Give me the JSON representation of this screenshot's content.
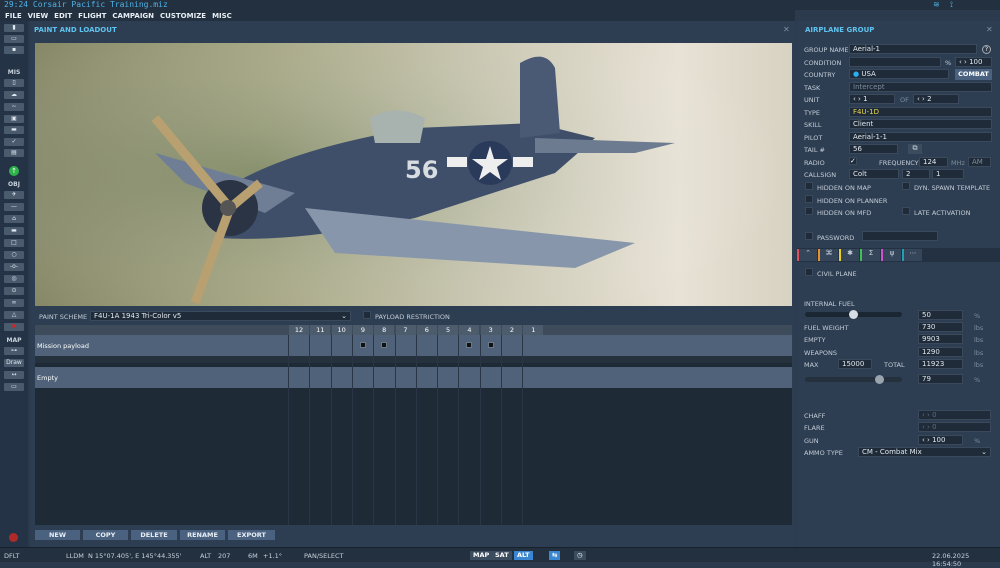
{
  "window": {
    "title": "29:24 Corsair Pacific Training.miz"
  },
  "menu": [
    "FILE",
    "VIEW",
    "EDIT",
    "FLIGHT",
    "CAMPAIGN",
    "CUSTOMIZE",
    "MISC"
  ],
  "toolbar": {
    "sections": [
      "MIS",
      "OBJ",
      "MAP"
    ],
    "map_buttons": [
      "Draw"
    ]
  },
  "loadout": {
    "title": "PAINT AND LOADOUT",
    "paint_scheme_label": "PAINT SCHEME",
    "paint_scheme": "F4U-1A 1943 Tri-Color v5",
    "payload_restriction": "PAYLOAD RESTRICTION",
    "stations": [
      "12",
      "11",
      "10",
      "9",
      "8",
      "7",
      "6",
      "5",
      "4",
      "3",
      "2",
      "1"
    ],
    "rows": [
      {
        "name": "Mission payload",
        "loaded": [
          "9",
          "8",
          "4",
          "3"
        ]
      },
      {
        "name": "Empty",
        "loaded": []
      }
    ],
    "buttons": [
      "NEW",
      "COPY",
      "DELETE",
      "RENAME",
      "EXPORT"
    ],
    "aircraft_marking": "56"
  },
  "group": {
    "title": "AIRPLANE GROUP",
    "group_name_label": "GROUP NAME",
    "group_name": "Aerial-1",
    "help": "?",
    "condition_label": "CONDITION",
    "condition_unit": "%",
    "condition": "100",
    "country_label": "COUNTRY",
    "country": "USA",
    "combat": "COMBAT",
    "task_label": "TASK",
    "task": "Intercept",
    "unit_label": "UNIT",
    "unit": "1",
    "of": "OF",
    "unit_of": "2",
    "type_label": "TYPE",
    "type": "F4U-1D",
    "skill_label": "SKILL",
    "skill": "Client",
    "pilot_label": "PILOT",
    "pilot": "Aerial-1-1",
    "tail_label": "TAIL #",
    "tail": "56",
    "radio_label": "RADIO",
    "frequency_label": "FREQUENCY",
    "frequency": "124",
    "mhz": "MHz",
    "modulation": "AM",
    "callsign_label": "CALLSIGN",
    "callsign": "Colt",
    "callsign_n1": "2",
    "callsign_n2": "1",
    "hidden_map": "HIDDEN ON MAP",
    "dyn_spawn": "DYN. SPAWN TEMPLATE",
    "hidden_planner": "HIDDEN ON PLANNER",
    "hidden_mfd": "HIDDEN ON MFD",
    "late_activation": "LATE ACTIVATION",
    "password": "PASSWORD",
    "tab_colors": [
      "#e0505a",
      "#e8902a",
      "#e8d020",
      "#40c050",
      "#d050d0",
      "#20a0b0"
    ],
    "civil_plane": "CIVIL PLANE",
    "internal_fuel_label": "INTERNAL FUEL",
    "internal_fuel": "50",
    "pct": "%",
    "fuel_weight_label": "FUEL WEIGHT",
    "fuel_weight": "730",
    "lbs": "lbs",
    "empty_label": "EMPTY",
    "empty": "9903",
    "weapons_label": "WEAPONS",
    "weapons": "1290",
    "max_label": "MAX",
    "max": "15000",
    "total_label": "TOTAL",
    "total": "11923",
    "load_pct": "79",
    "chaff_label": "CHAFF",
    "chaff": "0",
    "flare_label": "FLARE",
    "flare": "0",
    "gun_label": "GUN",
    "gun": "100",
    "ammo_label": "AMMO TYPE",
    "ammo": "CM - Combat Mix"
  },
  "status": {
    "profile": "DFLT",
    "coord_mode": "LLDM",
    "coords": "N 15°07.405', E 145°44.355'",
    "alt_label": "ALT",
    "alt": "207",
    "magvar_label": "6M",
    "magvar": "+1.1°",
    "mode": "PAN/SELECT",
    "map": "MAP",
    "sat": "SAT",
    "alt_btn": "ALT",
    "datetime": "22.06.2025 16:54:50"
  }
}
